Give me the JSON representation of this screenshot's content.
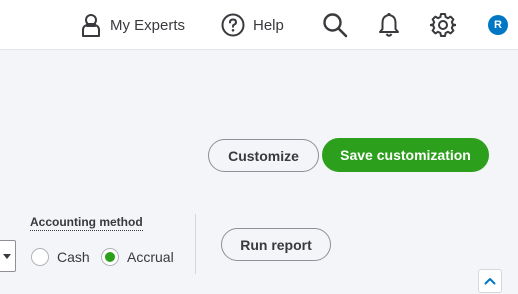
{
  "header": {
    "my_experts_label": "My Experts",
    "help_label": "Help",
    "avatar_initial": "R"
  },
  "actions": {
    "customize_label": "Customize",
    "save_customization_label": "Save customization"
  },
  "report_options": {
    "accounting_method_label": "Accounting method",
    "methods": [
      {
        "label": "Cash",
        "selected": false
      },
      {
        "label": "Accrual",
        "selected": true
      }
    ],
    "run_report_label": "Run report"
  },
  "icons": {
    "experts": "person-icon",
    "help": "question-circle-icon",
    "search": "search-icon",
    "notifications": "bell-icon",
    "settings": "gear-icon",
    "scroll_top": "chevron-up-icon"
  },
  "colors": {
    "primary_green": "#2ca01c",
    "avatar_blue": "#0077c5",
    "text_dark": "#393a3d"
  }
}
